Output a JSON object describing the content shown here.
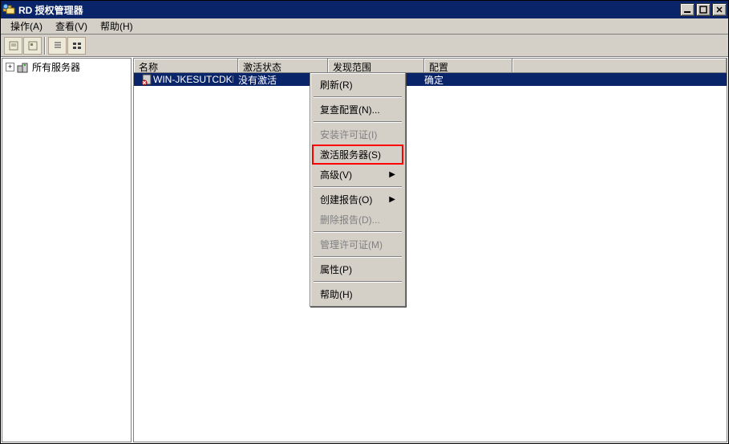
{
  "title": "RD 授权管理器",
  "menubar": {
    "action": "操作(A)",
    "view": "查看(V)",
    "help": "帮助(H)"
  },
  "tree": {
    "root": "所有服务器"
  },
  "columns": {
    "name": "名称",
    "status": "激活状态",
    "scope": "发现范围",
    "config": "配置"
  },
  "row": {
    "name": "WIN-JKESUTCDKFE",
    "status": "没有激活",
    "scope": "",
    "config": "确定"
  },
  "context_menu": {
    "refresh": "刷新(R)",
    "review_config": "复查配置(N)...",
    "install_license": "安装许可证(I)",
    "activate_server": "激活服务器(S)",
    "advanced": "高级(V)",
    "create_report": "创建报告(O)",
    "delete_report": "删除报告(D)...",
    "manage_license": "管理许可证(M)",
    "properties": "属性(P)",
    "help": "帮助(H)"
  }
}
